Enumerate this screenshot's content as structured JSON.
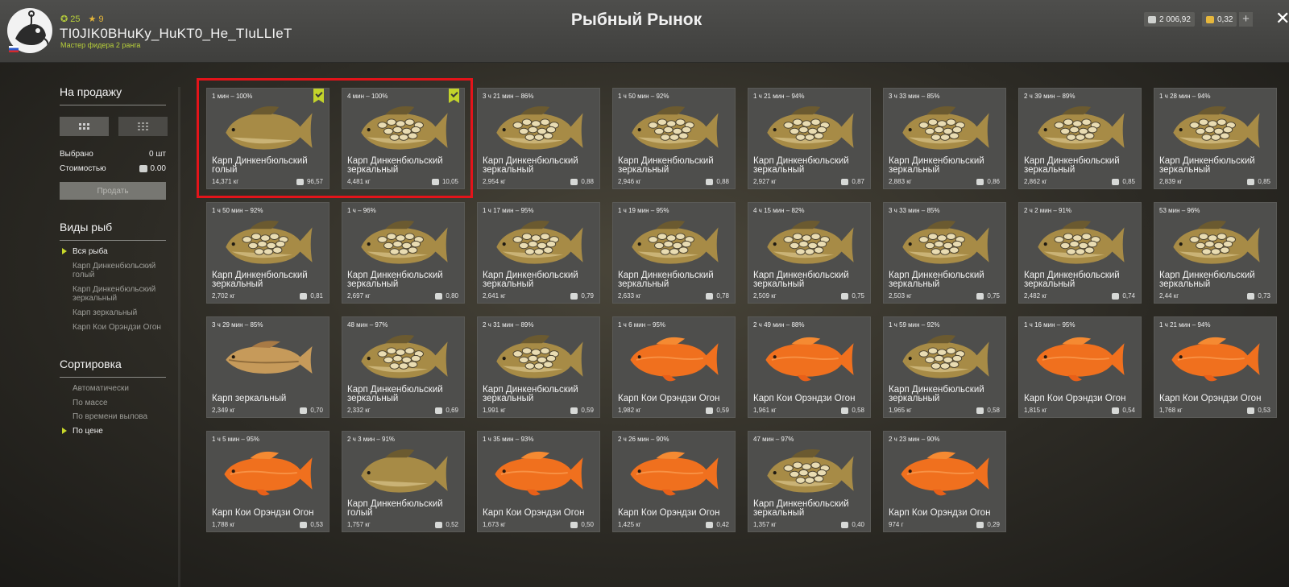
{
  "header": {
    "stat_level": "25",
    "stat_stars": "9",
    "username": "TI0JIK0BHuKy_HuKT0_He_TIuLLIeT",
    "rank": "Мастер фидера 2 ранга",
    "title": "Рыбный Рынок",
    "silver_amount": "2 006,92",
    "gold_amount": "0,32",
    "plus_label": "+",
    "close_label": "✕"
  },
  "sidebar": {
    "sale_title": "На продажу",
    "selected_label": "Выбрано",
    "selected_value": "0 шт",
    "cost_label": "Стоимостью",
    "cost_value": "0.00",
    "sell_button": "Продать",
    "fish_types_title": "Виды рыб",
    "fish_types": [
      {
        "label": "Вся рыба",
        "active": true
      },
      {
        "label": "Карп Динкенбюльский голый",
        "active": false
      },
      {
        "label": "Карп Динкенбюльский зеркальный",
        "active": false
      },
      {
        "label": "Карп зеркальный",
        "active": false
      },
      {
        "label": "Карп Кои Орэндзи Огон",
        "active": false
      }
    ],
    "sort_title": "Сортировка",
    "sort_options": [
      {
        "label": "Автоматически",
        "active": false
      },
      {
        "label": "По массе",
        "active": false
      },
      {
        "label": "По времени вылова",
        "active": false
      },
      {
        "label": "По цене",
        "active": true
      }
    ]
  },
  "colors": {
    "accent": "#c8d82a",
    "highlight_box": "#e3141a",
    "koi_orange": "#f0701e",
    "carp_gold": "#b69a4e"
  },
  "fish": [
    {
      "time": "1 мин – 100%",
      "name": "Карп Динкенбюльский голый",
      "weight": "14,371 кг",
      "price": "96,57",
      "kind": "naked",
      "selected": true
    },
    {
      "time": "4 мин – 100%",
      "name": "Карп Динкенбюльский зеркальный",
      "weight": "4,481 кг",
      "price": "10,05",
      "kind": "mirror",
      "selected": true
    },
    {
      "time": "3 ч 21 мин – 86%",
      "name": "Карп Динкенбюльский зеркальный",
      "weight": "2,954 кг",
      "price": "0,88",
      "kind": "mirror",
      "selected": false
    },
    {
      "time": "1 ч 50 мин – 92%",
      "name": "Карп Динкенбюльский зеркальный",
      "weight": "2,946 кг",
      "price": "0,88",
      "kind": "mirror",
      "selected": false
    },
    {
      "time": "1 ч 21 мин – 94%",
      "name": "Карп Динкенбюльский зеркальный",
      "weight": "2,927 кг",
      "price": "0,87",
      "kind": "mirror",
      "selected": false
    },
    {
      "time": "3 ч 33 мин – 85%",
      "name": "Карп Динкенбюльский зеркальный",
      "weight": "2,883 кг",
      "price": "0,86",
      "kind": "mirror",
      "selected": false
    },
    {
      "time": "2 ч 39 мин – 89%",
      "name": "Карп Динкенбюльский зеркальный",
      "weight": "2,862 кг",
      "price": "0,85",
      "kind": "mirror",
      "selected": false
    },
    {
      "time": "1 ч 28 мин – 94%",
      "name": "Карп Динкенбюльский зеркальный",
      "weight": "2,839 кг",
      "price": "0,85",
      "kind": "mirror",
      "selected": false
    },
    {
      "time": "1 ч 50 мин – 92%",
      "name": "Карп Динкенбюльский зеркальный",
      "weight": "2,702 кг",
      "price": "0,81",
      "kind": "mirror",
      "selected": false
    },
    {
      "time": "1 ч – 96%",
      "name": "Карп Динкенбюльский зеркальный",
      "weight": "2,697 кг",
      "price": "0,80",
      "kind": "mirror",
      "selected": false
    },
    {
      "time": "1 ч 17 мин – 95%",
      "name": "Карп Динкенбюльский зеркальный",
      "weight": "2,641 кг",
      "price": "0,79",
      "kind": "mirror",
      "selected": false
    },
    {
      "time": "1 ч 19 мин – 95%",
      "name": "Карп Динкенбюльский зеркальный",
      "weight": "2,633 кг",
      "price": "0,78",
      "kind": "mirror",
      "selected": false
    },
    {
      "time": "4 ч 15 мин – 82%",
      "name": "Карп Динкенбюльский зеркальный",
      "weight": "2,509 кг",
      "price": "0,75",
      "kind": "mirror",
      "selected": false
    },
    {
      "time": "3 ч 33 мин – 85%",
      "name": "Карп Динкенбюльский зеркальный",
      "weight": "2,503 кг",
      "price": "0,75",
      "kind": "mirror",
      "selected": false
    },
    {
      "time": "2 ч 2 мин – 91%",
      "name": "Карп Динкенбюльский зеркальный",
      "weight": "2,482 кг",
      "price": "0,74",
      "kind": "mirror",
      "selected": false
    },
    {
      "time": "53 мин – 96%",
      "name": "Карп Динкенбюльский зеркальный",
      "weight": "2,44 кг",
      "price": "0,73",
      "kind": "mirror",
      "selected": false
    },
    {
      "time": "3 ч 29 мин – 85%",
      "name": "Карп зеркальный",
      "weight": "2,349 кг",
      "price": "0,70",
      "kind": "plain",
      "selected": false
    },
    {
      "time": "48 мин – 97%",
      "name": "Карп Динкенбюльский зеркальный",
      "weight": "2,332 кг",
      "price": "0,69",
      "kind": "mirror",
      "selected": false
    },
    {
      "time": "2 ч 31 мин – 89%",
      "name": "Карп Динкенбюльский зеркальный",
      "weight": "1,991 кг",
      "price": "0,59",
      "kind": "mirror",
      "selected": false
    },
    {
      "time": "1 ч 6 мин – 95%",
      "name": "Карп Кои Орэндзи Огон",
      "weight": "1,982 кг",
      "price": "0,59",
      "kind": "koi",
      "selected": false
    },
    {
      "time": "2 ч 49 мин – 88%",
      "name": "Карп Кои Орэндзи Огон",
      "weight": "1,961 кг",
      "price": "0,58",
      "kind": "koi",
      "selected": false
    },
    {
      "time": "1 ч 59 мин – 92%",
      "name": "Карп Динкенбюльский зеркальный",
      "weight": "1,965 кг",
      "price": "0,58",
      "kind": "mirror",
      "selected": false
    },
    {
      "time": "1 ч 16 мин – 95%",
      "name": "Карп Кои Орэндзи Огон",
      "weight": "1,815 кг",
      "price": "0,54",
      "kind": "koi",
      "selected": false
    },
    {
      "time": "1 ч 21 мин – 94%",
      "name": "Карп Кои Орэндзи Огон",
      "weight": "1,768 кг",
      "price": "0,53",
      "kind": "koi",
      "selected": false
    },
    {
      "time": "1 ч 5 мин – 95%",
      "name": "Карп Кои Орэндзи Огон",
      "weight": "1,788 кг",
      "price": "0,53",
      "kind": "koi",
      "selected": false
    },
    {
      "time": "2 ч 3 мин – 91%",
      "name": "Карп Динкенбюльский голый",
      "weight": "1,757 кг",
      "price": "0,52",
      "kind": "naked",
      "selected": false
    },
    {
      "time": "1 ч 35 мин – 93%",
      "name": "Карп Кои Орэндзи Огон",
      "weight": "1,673 кг",
      "price": "0,50",
      "kind": "koi",
      "selected": false
    },
    {
      "time": "2 ч 26 мин – 90%",
      "name": "Карп Кои Орэндзи Огон",
      "weight": "1,425 кг",
      "price": "0,42",
      "kind": "koi",
      "selected": false
    },
    {
      "time": "47 мин – 97%",
      "name": "Карп Динкенбюльский зеркальный",
      "weight": "1,357 кг",
      "price": "0,40",
      "kind": "mirror",
      "selected": false
    },
    {
      "time": "2 ч 23 мин – 90%",
      "name": "Карп Кои Орэндзи Огон",
      "weight": "974 г",
      "price": "0,29",
      "kind": "koi",
      "selected": false
    }
  ]
}
